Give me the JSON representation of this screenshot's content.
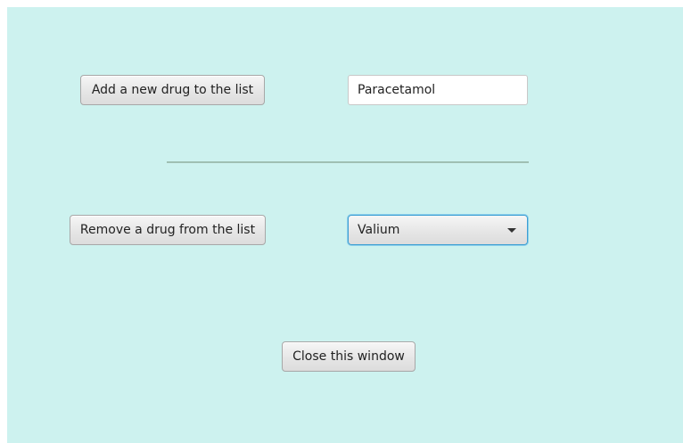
{
  "form": {
    "add_button_label": "Add a new drug to the list",
    "new_drug_value": "Paracetamol",
    "remove_button_label": "Remove a drug from the list",
    "drug_select_value": "Valium",
    "close_button_label": "Close this window"
  },
  "colors": {
    "background": "#cdf2ef",
    "separator": "#9fbfb3",
    "focus_border": "#3c9fd3"
  },
  "icons": {
    "dropdown": "chevron-down-icon"
  }
}
